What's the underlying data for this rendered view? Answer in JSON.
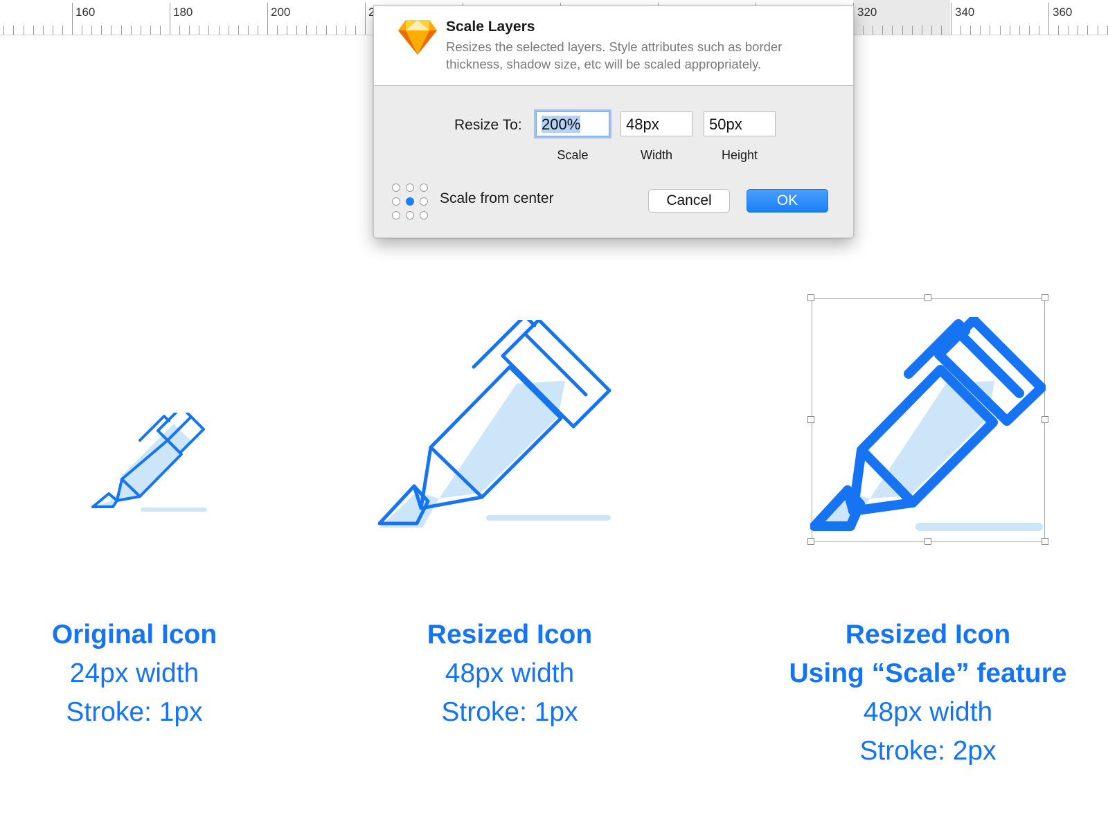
{
  "ruler": {
    "numbers": [
      "160",
      "180",
      "200",
      "2",
      "320",
      "340",
      "360"
    ]
  },
  "dialog": {
    "title": "Scale Layers",
    "description": "Resizes the selected layers. Style attributes such as border thickness, shadow size, etc will be scaled appropriately.",
    "resize_label": "Resize To:",
    "scale_value": "200%",
    "scale_caption": "Scale",
    "width_value": "48px",
    "width_caption": "Width",
    "height_value": "50px",
    "height_caption": "Height",
    "scale_from_center_label": "Scale from center",
    "cancel_label": "Cancel",
    "ok_label": "OK"
  },
  "captions": {
    "original": {
      "title": "Original Icon",
      "line1": "24px width",
      "line2": "Stroke: 1px"
    },
    "resized": {
      "title": "Resized Icon",
      "line1": "48px width",
      "line2": "Stroke: 1px"
    },
    "scaled": {
      "title": "Resized Icon",
      "title2": "Using “Scale” feature",
      "line1": "48px width",
      "line2": "Stroke: 2px"
    }
  },
  "colors": {
    "accent": "#1674f3",
    "icon_stroke": "#1674f3",
    "icon_fill": "#cde5f9",
    "ok_button": "#1a7ff5"
  },
  "icons": {
    "app": "sketch-diamond-icon",
    "anchor": "anchor-grid-icon",
    "marker": "highlighter-icon"
  }
}
